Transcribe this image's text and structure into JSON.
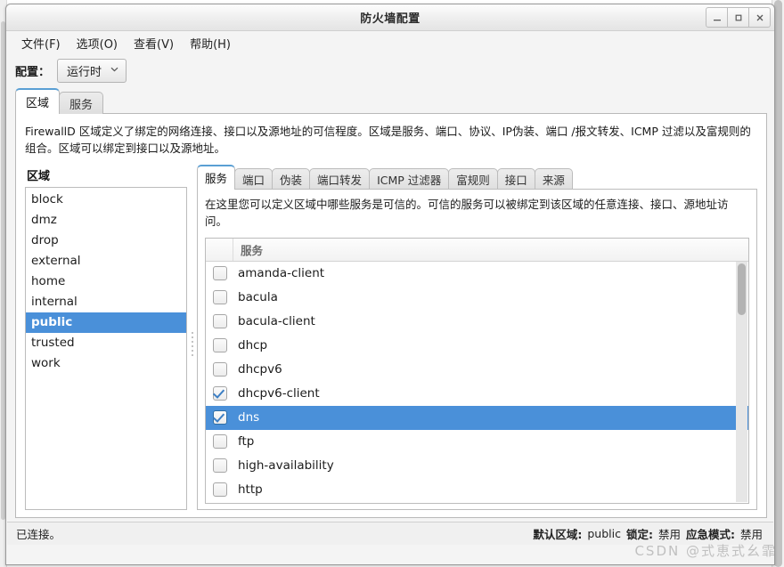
{
  "window": {
    "title": "防火墙配置",
    "controls": {
      "minimize": "_",
      "maximize": "□",
      "close": "✕"
    }
  },
  "menubar": {
    "items": [
      {
        "label": "文件(F)"
      },
      {
        "label": "选项(O)"
      },
      {
        "label": "查看(V)"
      },
      {
        "label": "帮助(H)"
      }
    ]
  },
  "config": {
    "label": "配置：",
    "selected": "运行时",
    "chevron": "⌄"
  },
  "outer_tabs": [
    {
      "label": "区域",
      "active": true
    },
    {
      "label": "服务",
      "active": false
    }
  ],
  "zone_description": "FirewallD 区域定义了绑定的网络连接、接口以及源地址的可信程度。区域是服务、端口、协议、IP伪装、端口 /报文转发、ICMP 过滤以及富规则的组合。区域可以绑定到接口以及源地址。",
  "zones_panel": {
    "title": "区域",
    "items": [
      {
        "name": "block",
        "selected": false
      },
      {
        "name": "dmz",
        "selected": false
      },
      {
        "name": "drop",
        "selected": false
      },
      {
        "name": "external",
        "selected": false
      },
      {
        "name": "home",
        "selected": false
      },
      {
        "name": "internal",
        "selected": false
      },
      {
        "name": "public",
        "selected": true
      },
      {
        "name": "trusted",
        "selected": false
      },
      {
        "name": "work",
        "selected": false
      }
    ]
  },
  "inner_tabs": [
    {
      "label": "服务",
      "active": true
    },
    {
      "label": "端口",
      "active": false
    },
    {
      "label": "伪装",
      "active": false
    },
    {
      "label": "端口转发",
      "active": false
    },
    {
      "label": "ICMP 过滤器",
      "active": false
    },
    {
      "label": "富规则",
      "active": false
    },
    {
      "label": "接口",
      "active": false
    },
    {
      "label": "来源",
      "active": false
    }
  ],
  "services_description": "在这里您可以定义区域中哪些服务是可信的。可信的服务可以被绑定到该区域的任意连接、接口、源地址访问。",
  "services_table": {
    "column_header": "服务",
    "rows": [
      {
        "name": "amanda-client",
        "checked": false,
        "selected": false
      },
      {
        "name": "bacula",
        "checked": false,
        "selected": false
      },
      {
        "name": "bacula-client",
        "checked": false,
        "selected": false
      },
      {
        "name": "dhcp",
        "checked": false,
        "selected": false
      },
      {
        "name": "dhcpv6",
        "checked": false,
        "selected": false
      },
      {
        "name": "dhcpv6-client",
        "checked": true,
        "selected": false
      },
      {
        "name": "dns",
        "checked": true,
        "selected": true
      },
      {
        "name": "ftp",
        "checked": false,
        "selected": false
      },
      {
        "name": "high-availability",
        "checked": false,
        "selected": false
      },
      {
        "name": "http",
        "checked": false,
        "selected": false
      }
    ]
  },
  "statusbar": {
    "connection": "已连接。",
    "default_zone_label": "默认区域:",
    "default_zone_value": "public",
    "lockdown_label": "锁定:",
    "lockdown_value": "禁用",
    "panic_label": "应急模式:",
    "panic_value": "禁用"
  },
  "watermark": "CSDN @式恵式幺霏",
  "colors": {
    "selection": "#4a90d9",
    "window_bg": "#f4f4f4",
    "tab_active_top": "#5a9fd4",
    "check": "#3d7fc4"
  }
}
